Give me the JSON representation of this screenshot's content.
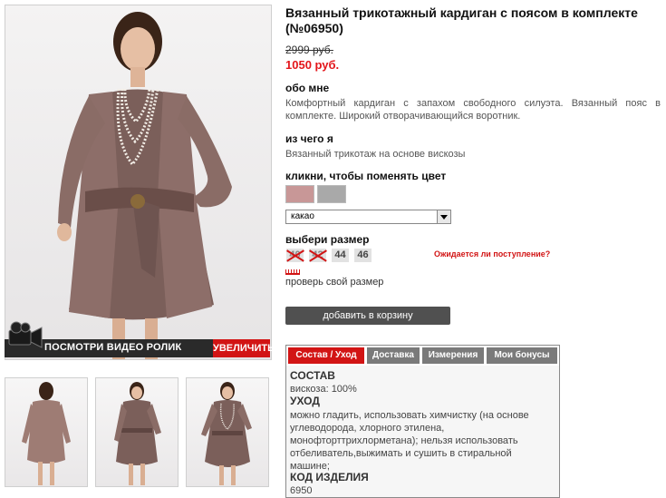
{
  "product": {
    "title": "Вязанный трикотажный кардиган с поясом в комплекте (№06950)",
    "old_price": "2999 руб.",
    "new_price": "1050 руб."
  },
  "about": {
    "heading": "обо мне",
    "text": "Комфортный кардиган с запахом свободного силуэта. Вязанный пояс в комплекте. Широкий отворачивающийся воротник."
  },
  "material": {
    "heading": "из чего я",
    "text": "Вязанный трикотаж на основе вискозы"
  },
  "color": {
    "heading": "кликни, чтобы поменять цвет",
    "swatches": [
      "#c89797",
      "#a9a9a9"
    ],
    "selected": "какао"
  },
  "size": {
    "heading": "выбери размер",
    "options": [
      {
        "label": "40",
        "available": false
      },
      {
        "label": "42",
        "available": false
      },
      {
        "label": "44",
        "available": true
      },
      {
        "label": "46",
        "available": true
      }
    ],
    "expect_link": "Ожидается ли поступление?",
    "check_link": "проверь свой размер"
  },
  "cart_button": "добавить в корзину",
  "media": {
    "video_label": "ПОСМОТРИ ВИДЕО РОЛИК",
    "zoom_label": "УВЕЛИЧИТЬ"
  },
  "tabs": [
    {
      "label": "Состав / Уход",
      "active": true
    },
    {
      "label": "Доставка",
      "active": false
    },
    {
      "label": "Измерения",
      "active": false
    },
    {
      "label": "Мои бонусы",
      "active": false
    }
  ],
  "tab_content": {
    "composition_heading": "СОСТАВ",
    "composition": "вискоза: 100%",
    "care_heading": "УХОД",
    "care": "можно гладить, использовать химчистку (на основе углеводорода, хлорного этилена, монофторттрихлорметана); нельзя использовать отбеливатель,выжимать и сушить в стиральной машине;",
    "code_heading": "КОД ИЗДЕЛИЯ",
    "code": "6950"
  },
  "colors": {
    "accent": "#d21414",
    "price": "#e3161b",
    "button": "#505050"
  }
}
